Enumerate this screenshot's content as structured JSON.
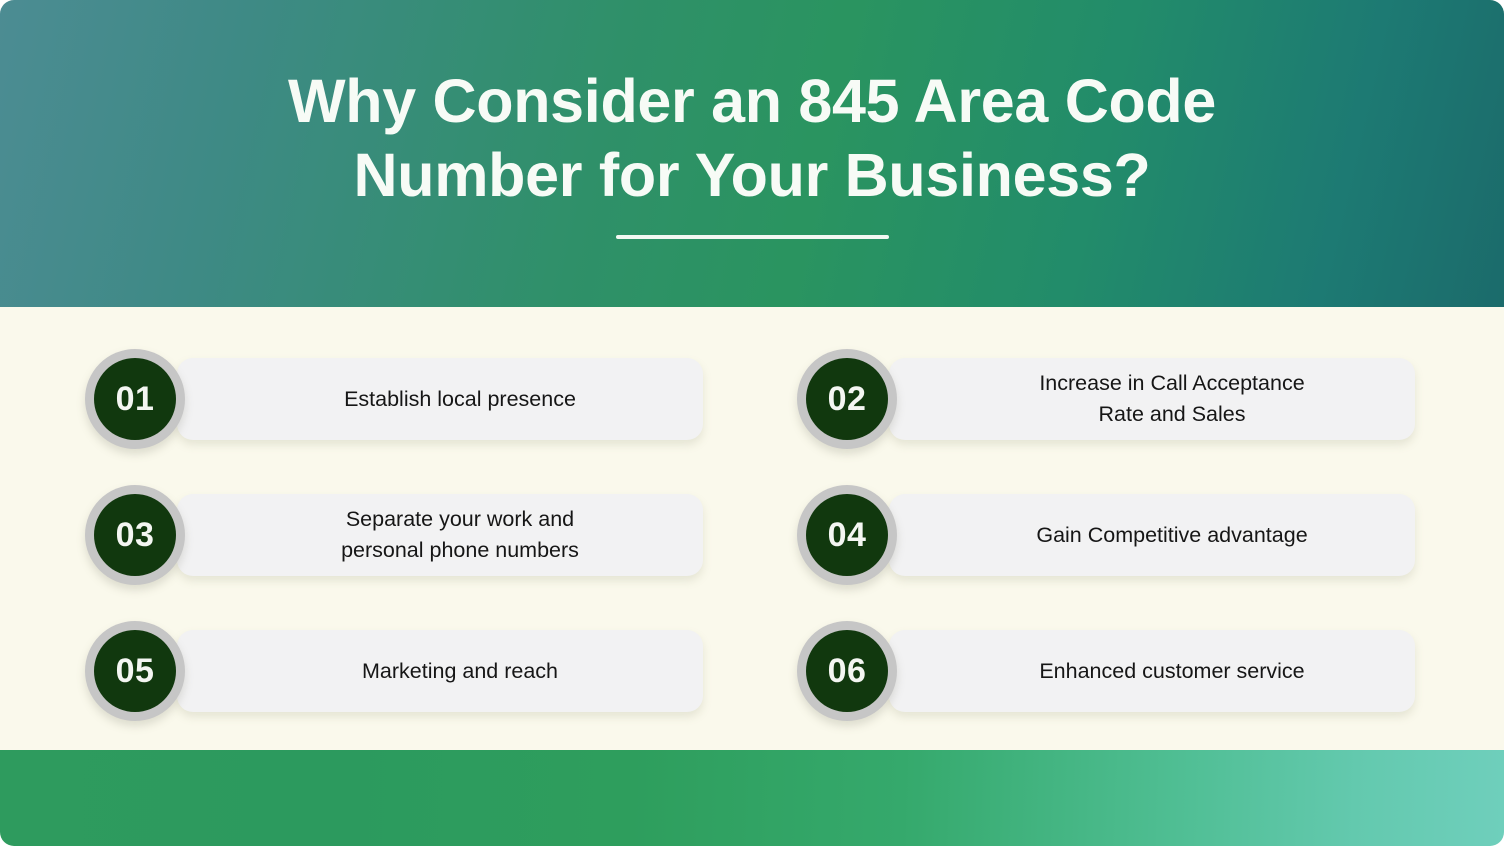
{
  "header": {
    "title": "Why Consider an 845 Area Code Number for Your Business?",
    "divider": "horizontal-rule",
    "gradient_from": "#4C8C93",
    "gradient_mid": "#2A9460",
    "gradient_to": "#1B6B6B",
    "title_color": "#F7FBF6"
  },
  "theme": {
    "page_background": "#FAF9EC",
    "card_background": "#F2F2F3",
    "badge_ring": "#C6C6C6",
    "badge_fill": "#11380E",
    "badge_text": "#F4F6F2",
    "card_text": "#161616",
    "footer_from": "#2E9B5E",
    "footer_to": "#6FCFBC"
  },
  "items": [
    {
      "number": "01",
      "label": "Establish local presence"
    },
    {
      "number": "02",
      "label": "Increase in Call Acceptance\nRate and Sales"
    },
    {
      "number": "03",
      "label": "Separate your work and\npersonal phone numbers"
    },
    {
      "number": "04",
      "label": "Gain Competitive advantage"
    },
    {
      "number": "05",
      "label": "Marketing and reach"
    },
    {
      "number": "06",
      "label": "Enhanced customer service"
    }
  ]
}
